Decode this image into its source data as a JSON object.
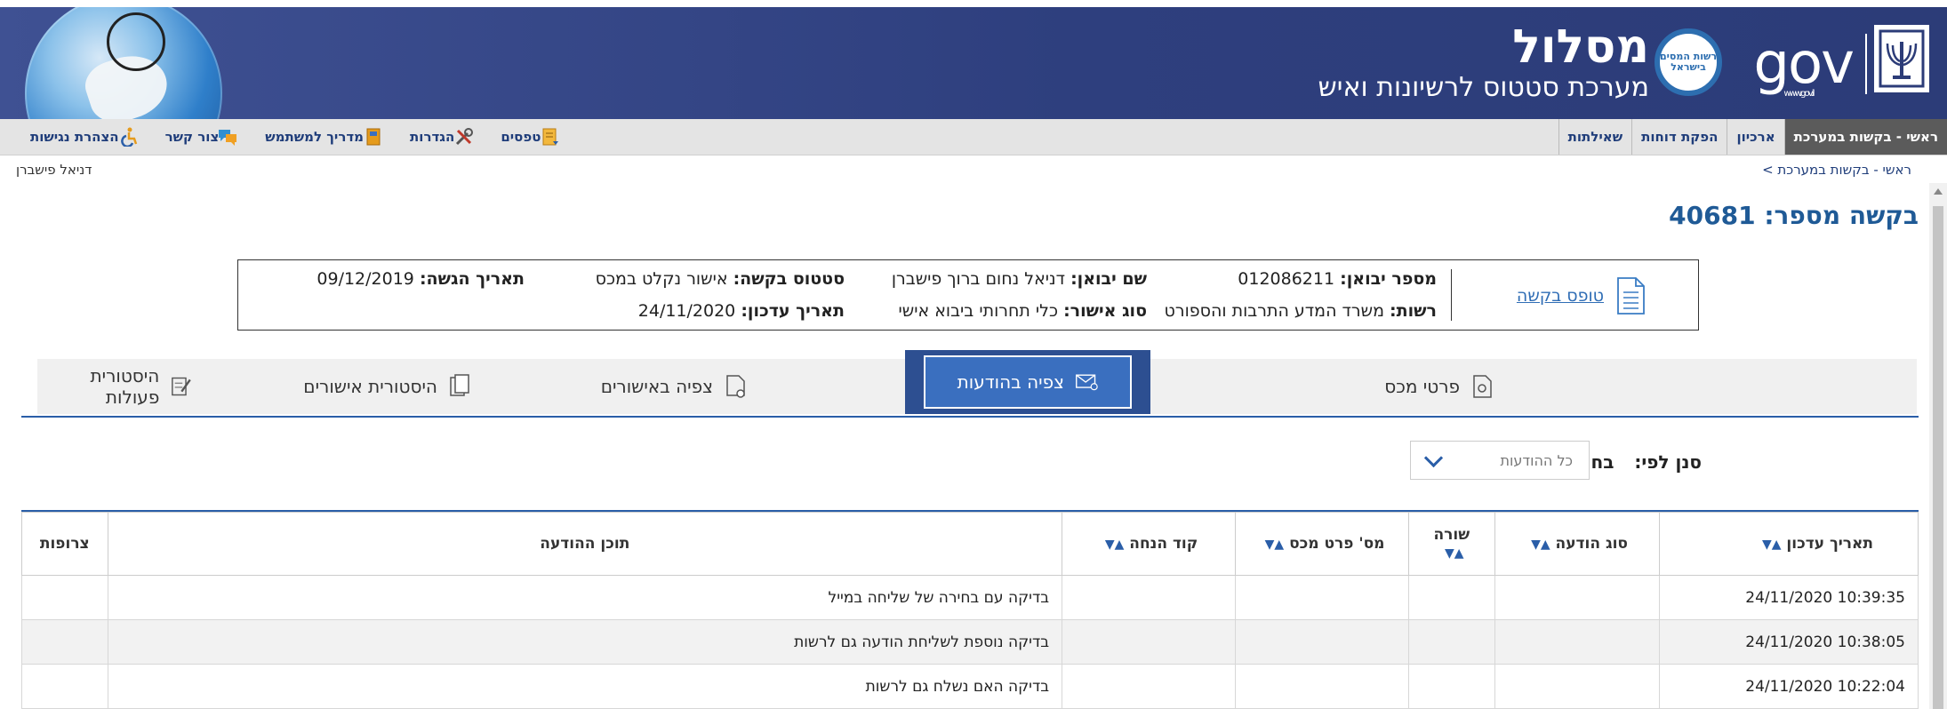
{
  "header": {
    "logo_title": "מסלול",
    "logo_subtitle": "מערכת סטטוס לרשיונות ואיש",
    "seal_text": "רשות המסים בישראל",
    "gov_word": "gov",
    "gov_small": "www.gov.il"
  },
  "nav": {
    "main": [
      "ראשי - בקשות במערכת",
      "ארכיון",
      "הפקת דוחות",
      "שאילתות"
    ],
    "tools": [
      "טפסים",
      "הגדרות",
      "מדריך למשתמש",
      "צור קשר",
      "הצהרת נגישות"
    ]
  },
  "breadcrumb": "ראשי - בקשות במערכת >",
  "user_name": "דניאל פישברן",
  "page_title": "בקשה מספר: 40681",
  "request": {
    "form_link": "טופס בקשה",
    "importer_no_label": "מספר יבואן:",
    "importer_no": "012086211",
    "importer_name_label": "שם יבואן:",
    "importer_name": "דניאל נחום ברוך פישברן",
    "status_label": "סטטוס בקשה:",
    "status": "אישור נקלט במכס",
    "submit_date_label": "תאריך הגשה:",
    "submit_date": "09/12/2019",
    "authority_label": "רשות:",
    "authority": "משרד המדע התרבות והספורט",
    "approval_type_label": "סוג אישור:",
    "approval_type": "כלי תחרותי ביבוא אישי",
    "update_date_label": "תאריך עדכון:",
    "update_date": "24/11/2020"
  },
  "tabs": [
    "פרטי מכס",
    "צפיה בהודעות",
    "צפיה באישורים",
    "היסטורית אישורים",
    "היסטורית פעולות"
  ],
  "active_tab": "צפיה בהודעות",
  "filter": {
    "label": "סנן לפי:",
    "choose": "בחר",
    "selected": "כל ההודעות"
  },
  "table": {
    "columns": [
      "תאריך עדכון",
      "סוג הודעה",
      "שורה",
      "מס' פרט מכס",
      "קוד הנחה",
      "תוכן ההודעה",
      "צרופות"
    ],
    "rows": [
      {
        "date": "24/11/2020 10:39:35",
        "type": "",
        "line": "",
        "item": "",
        "code": "",
        "content": "בדיקה עם בחירה של שליחה במייל",
        "attach": ""
      },
      {
        "date": "24/11/2020 10:38:05",
        "type": "",
        "line": "",
        "item": "",
        "code": "",
        "content": "בדיקה נוספת לשליחת הודעה גם לרשות",
        "attach": ""
      },
      {
        "date": "24/11/2020 10:22:04",
        "type": "",
        "line": "",
        "item": "",
        "code": "",
        "content": "בדיקה האם נשלח גם לרשות",
        "attach": ""
      }
    ]
  }
}
